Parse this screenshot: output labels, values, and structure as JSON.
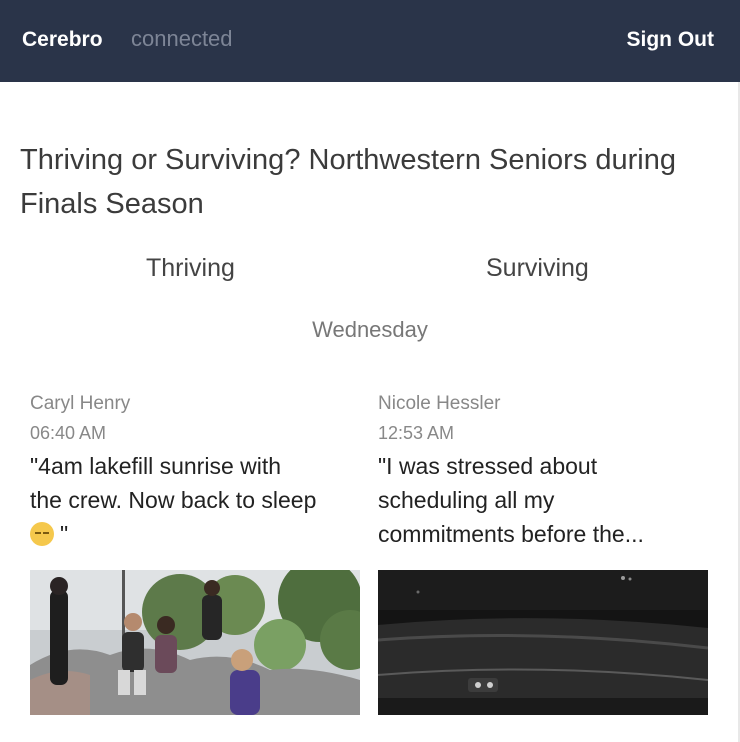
{
  "navbar": {
    "brand": "Cerebro",
    "status": "connected",
    "sign_out": "Sign Out",
    "background": "#2a3449"
  },
  "page": {
    "title": "Thriving or Surviving? Northwestern Seniors during Finals Season"
  },
  "tabs": [
    {
      "label": "Thriving"
    },
    {
      "label": "Surviving"
    }
  ],
  "day_label": "Wednesday",
  "posts": [
    {
      "author": "Caryl Henry",
      "time": "06:40 AM",
      "quote_lines": [
        "\"4am lakefill sunrise with",
        "the crew. Now back to sleep"
      ],
      "quote_tail": "\"",
      "emoji_icon": "sleepy-face-emoji",
      "photo_icon": "group-photo-outdoors"
    },
    {
      "author": "Nicole Hessler",
      "time": "12:53 AM",
      "quote_lines": [
        "\"I was stressed about",
        "scheduling all my",
        "commitments before the..."
      ],
      "photo_icon": "car-dashboard-night-photo"
    }
  ]
}
